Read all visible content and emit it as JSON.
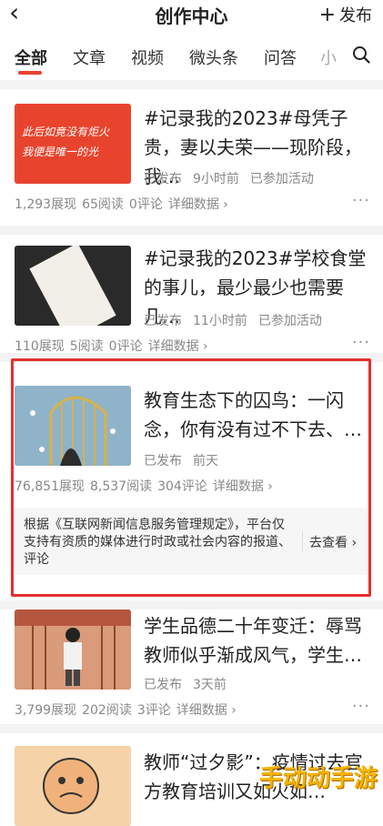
{
  "header": {
    "back_glyph": "‹",
    "title": "创作中心",
    "publish_label": "发布"
  },
  "tabs": [
    {
      "label": "全部",
      "active": true
    },
    {
      "label": "文章"
    },
    {
      "label": "视频"
    },
    {
      "label": "微头条"
    },
    {
      "label": "问答"
    },
    {
      "label": "小"
    }
  ],
  "articles": [
    {
      "title": "#记录我的2023#母凭子贵，妻以夫荣——现阶段，我…",
      "status": [
        "已发布",
        "9小时前",
        "已参加活动"
      ],
      "stats": [
        "1,293展现",
        "65阅读",
        "0评论",
        "详细数据 ›"
      ],
      "thumb_text": [
        "此后如竟没有炬火",
        "我便是唯一的光"
      ]
    },
    {
      "title": "#记录我的2023#学校食堂的事儿，最少最少也需要几…",
      "status": [
        "已发布",
        "11小时前",
        "已参加活动"
      ],
      "stats": [
        "110展现",
        "5阅读",
        "0评论",
        "详细数据 ›"
      ]
    },
    {
      "title": "教育生态下的囚鸟：一闪念，你有没有过不下去、…",
      "status": [
        "已发布",
        "前天"
      ],
      "stats": [
        "76,851展现",
        "8,537阅读",
        "304评论",
        "详细数据 ›"
      ]
    },
    {
      "title": "学生品德二十年变迁：辱骂教师似乎渐成风气，学生…",
      "status": [
        "已发布",
        "3天前"
      ],
      "stats": [
        "3,799展现",
        "202阅读",
        "3评论",
        "详细数据 ›"
      ]
    },
    {
      "title": "教师“过夕影”：疫情过去官方教育培训又如火如…",
      "status": [],
      "stats": []
    }
  ],
  "notice": {
    "text": "根据《互联网新闻信息服务管理规定》，平台仅支持有资质的媒体进行时政或社会内容的报道、评论",
    "link": "去查看 ›"
  },
  "watermark": "手动动手游",
  "colors": {
    "accent": "#e8412f",
    "highlight": "#e52e2e"
  }
}
